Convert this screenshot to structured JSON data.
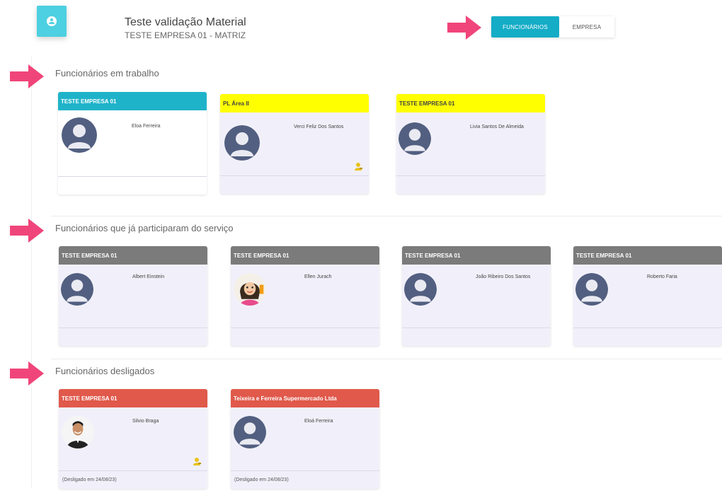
{
  "header": {
    "title": "Teste validação Material",
    "subtitle": "TESTE EMPRESA 01 - MATRIZ",
    "app_icon": "user-circle-icon"
  },
  "tabs": [
    {
      "label": "FUNCIONÁRIOS",
      "active": true
    },
    {
      "label": "EMPRESA",
      "active": false
    }
  ],
  "colors": {
    "accent": "#15acc6",
    "header_working_cyan": "#1fb3c9",
    "header_yellow": "#ffff00",
    "header_gray": "#7b7b7b",
    "header_red": "#e0594b",
    "arrow": "#f0457a",
    "avatar": "#525f80"
  },
  "sections": [
    {
      "title": "Funcionários em trabalho",
      "cards": [
        {
          "company": "TESTE EMPRESA 01",
          "name": "Eloa Ferreira",
          "footer": ""
        },
        {
          "company": "PL Área II",
          "name": "Verci Feliz Dos Santos",
          "footer": "",
          "badge": "person-key-icon"
        },
        {
          "company": "TESTE EMPRESA 01",
          "name": "Livia Santos De Almeida",
          "footer": ""
        }
      ]
    },
    {
      "title": "Funcionários que já participaram do serviço",
      "cards": [
        {
          "company": "TESTE EMPRESA 01",
          "name": "Albert Einstein",
          "footer": ""
        },
        {
          "company": "TESTE EMPRESA 01",
          "name": "Ellen Jurach",
          "footer": "",
          "photo": "woman-cartoon-avatar"
        },
        {
          "company": "TESTE EMPRESA 01",
          "name": "João Ribeiro Dos Santos",
          "footer": ""
        },
        {
          "company": "TESTE EMPRESA 01",
          "name": "Roberto Faria",
          "footer": ""
        }
      ]
    },
    {
      "title": "Funcionários desligados",
      "cards": [
        {
          "company": "TESTE EMPRESA 01",
          "name": "Silvio Braga",
          "footer": "(Desligado em 24/08/23)",
          "photo": "man-photo-avatar",
          "badge": "person-key-icon"
        },
        {
          "company": "Teixeira e Ferreira Supermercado Ltda",
          "name": "Eloá Ferreira",
          "footer": "(Desligado em 24/08/23)"
        }
      ]
    }
  ]
}
